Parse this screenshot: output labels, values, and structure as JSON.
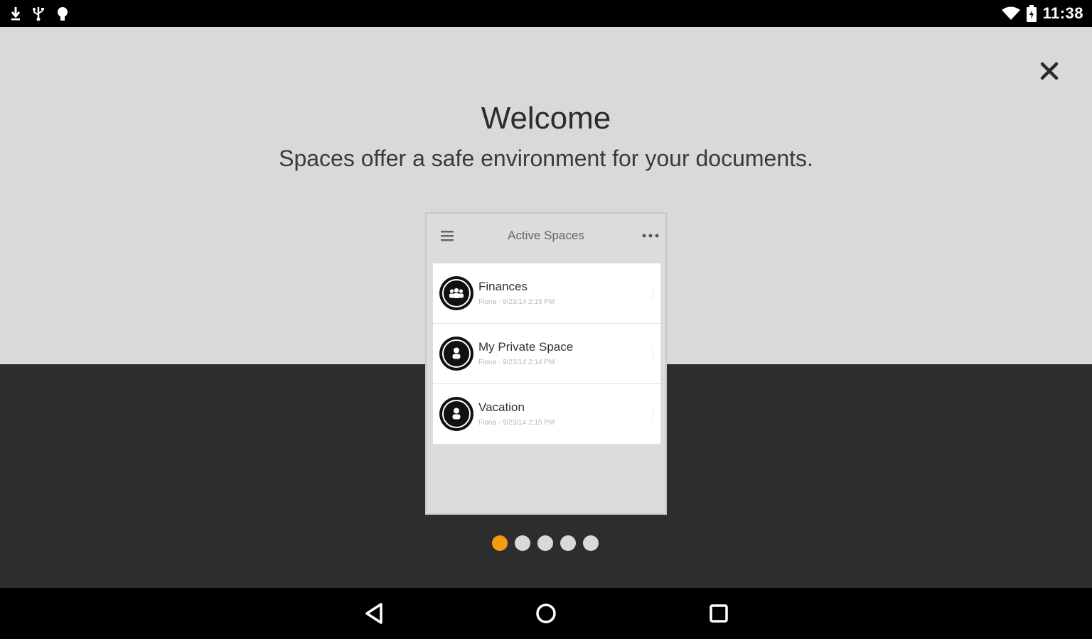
{
  "status_bar": {
    "time": "11:38",
    "left_icons": [
      "download-icon",
      "usb-icon",
      "debug-icon"
    ],
    "right_icons": [
      "wifi-icon",
      "battery-icon"
    ]
  },
  "welcome": {
    "title": "Welcome",
    "subtitle": "Spaces offer a safe environment for your documents."
  },
  "preview": {
    "header_title": "Active Spaces",
    "items": [
      {
        "name": "Finances",
        "meta": "Fiona - 9/23/14 2:15 PM",
        "icon": "group-icon"
      },
      {
        "name": "My Private Space",
        "meta": "Fiona - 9/23/14 2:14 PM",
        "icon": "person-icon"
      },
      {
        "name": "Vacation",
        "meta": "Fiona - 9/23/14 2:15 PM",
        "icon": "person-icon"
      }
    ]
  },
  "pager": {
    "count": 5,
    "active_index": 0,
    "active_color": "#f39c12",
    "inactive_color": "#d9d9d9"
  },
  "colors": {
    "top_panel": "#d9d9d9",
    "bottom_panel": "#2d2d2d",
    "bars": "#000000"
  }
}
